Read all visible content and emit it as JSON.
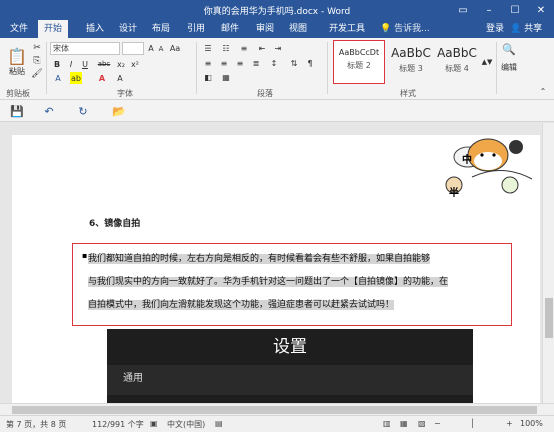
{
  "titlebar": {
    "title": "你真的会用华为手机吗.docx - Word",
    "icons": [
      "ribbon-options-icon",
      "minimize-icon",
      "maximize-icon",
      "close-icon"
    ]
  },
  "menu": {
    "tabs": [
      "文件",
      "开始",
      "插入",
      "设计",
      "布局",
      "引用",
      "邮件",
      "审阅",
      "视图",
      "开发工具"
    ],
    "active_tab": "开始",
    "tell_me": "告诉我...",
    "login": "登录",
    "share": "共享"
  },
  "ribbon": {
    "clipboard": {
      "paste": "粘贴",
      "label": "剪贴板"
    },
    "font": {
      "family": "宋体",
      "label": "字体",
      "bold": "B",
      "italic": "I",
      "underline": "U",
      "strike": "abc",
      "color_a": "A",
      "highlight_a": "A",
      "case": "Aa"
    },
    "paragraph": {
      "label": "段落"
    },
    "styles": {
      "label": "样式",
      "items": [
        {
          "preview": "AaBbCcDt",
          "name": "标题 2"
        },
        {
          "preview": "AaBbC",
          "name": "标题 3"
        },
        {
          "preview": "AaBbC",
          "name": "标题 4"
        }
      ]
    },
    "editing": {
      "label": "编辑"
    }
  },
  "document": {
    "heading": "6、镜像自拍",
    "paragraph": {
      "line1": "我们都知道自拍的时候，左右方向是相反的，有时候看着会有些不舒服，如果自拍能够",
      "line2": "与我们现实中的方向一致就好了。华为手机针对这一问题出了一个【自拍镜像】的功能，在",
      "line3": "自拍模式中，我们向左滑就能发现这个功能，强迫症患者可以赶紧去试试吗！"
    },
    "phone_screenshot": {
      "title": "设置",
      "row": "通用"
    },
    "sticker_text": [
      "中",
      "半"
    ]
  },
  "statusbar": {
    "page": "第 7 页，共 8 页",
    "words": "112/991 个字",
    "language": "中文(中国)",
    "zoom": "100%"
  },
  "colors": {
    "word_blue": "#2b579a",
    "highlight_red": "#d9363e"
  }
}
